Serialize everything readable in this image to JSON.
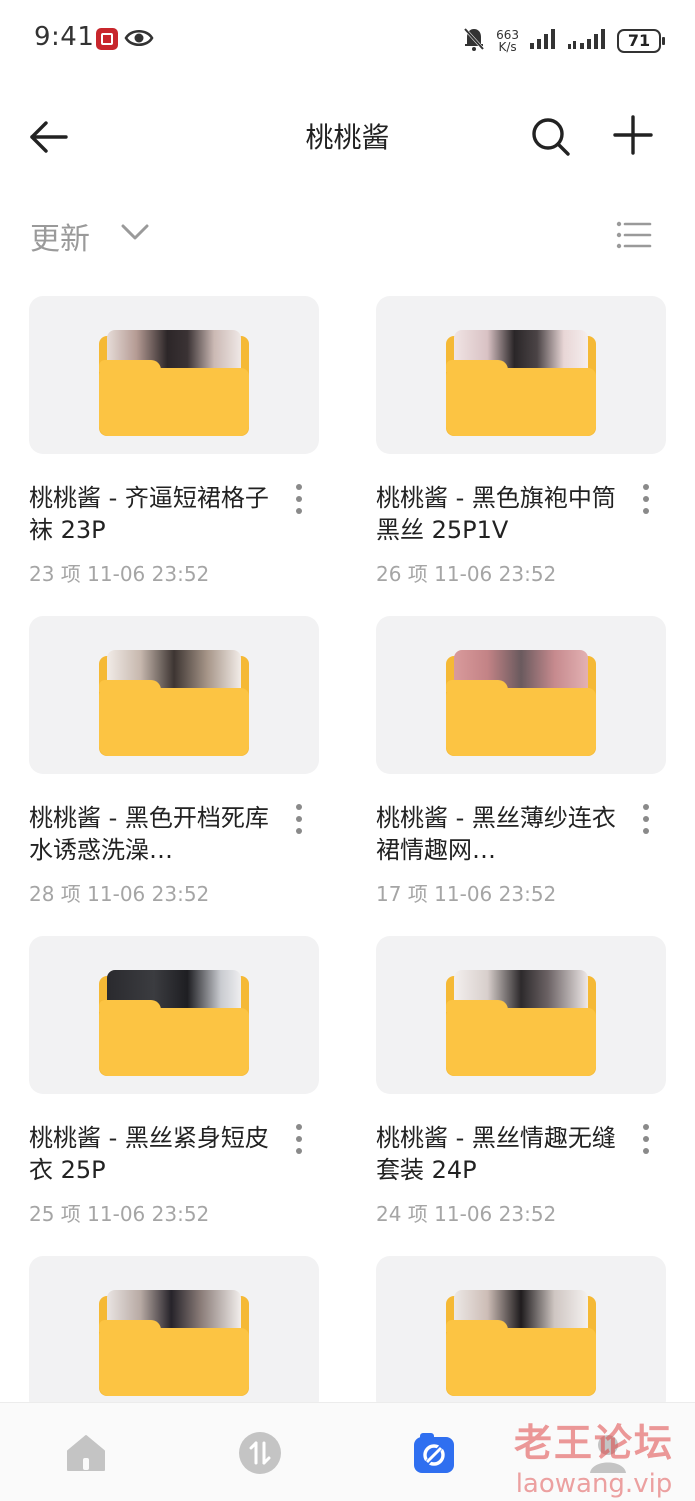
{
  "status_bar": {
    "time": "9:41",
    "speed_value": "663",
    "speed_unit": "K/s",
    "battery": "71"
  },
  "header": {
    "title": "桃桃酱"
  },
  "sort": {
    "label": "更新"
  },
  "folders": [
    {
      "name": "桃桃酱 - 齐逼短裙格子袜 23P",
      "meta": "23 项  11-06 23:52"
    },
    {
      "name": "桃桃酱 - 黑色旗袍中筒黑丝 25P1V",
      "meta": "26 项  11-06 23:52"
    },
    {
      "name": "桃桃酱 - 黑色开档死库水诱惑洗澡…",
      "meta": "28 项  11-06 23:52"
    },
    {
      "name": "桃桃酱 - 黑丝薄纱连衣裙情趣网…",
      "meta": "17 项  11-06 23:52"
    },
    {
      "name": "桃桃酱 - 黑丝紧身短皮衣 25P",
      "meta": "25 项  11-06 23:52"
    },
    {
      "name": "桃桃酱 - 黑丝情趣无缝套装 24P",
      "meta": "24 项  11-06 23:52"
    },
    {
      "name": "",
      "meta": ""
    },
    {
      "name": "",
      "meta": ""
    }
  ],
  "watermark": {
    "cn": "老王论坛",
    "en": "laowang.vip"
  },
  "colors": {
    "folder": "#fcc443",
    "accent": "#2f6ff0",
    "muted": "#a5a5a5"
  }
}
